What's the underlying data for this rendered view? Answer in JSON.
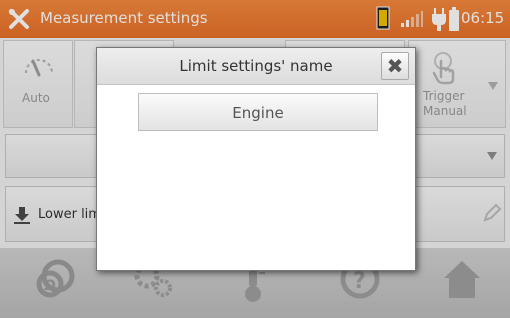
{
  "header": {
    "title": "Measurement settings",
    "time": "06:15",
    "icons": [
      "tools-icon",
      "battery-module-icon",
      "signal-icon",
      "plug-icon",
      "battery-icon"
    ],
    "accent": "#e8702a"
  },
  "panel": {
    "auto_label": "Auto",
    "trigger_label": "Trigger",
    "trigger_mode": "Manual",
    "lower_limit_label": "Lower lim"
  },
  "dialog": {
    "title": "Limit settings' name",
    "value": "Engine",
    "close_icon": "close-icon"
  },
  "bottom_nav": {
    "icons": [
      "meter-icon",
      "gears-icon",
      "thermometer-icon",
      "help-icon",
      "home-icon"
    ]
  }
}
